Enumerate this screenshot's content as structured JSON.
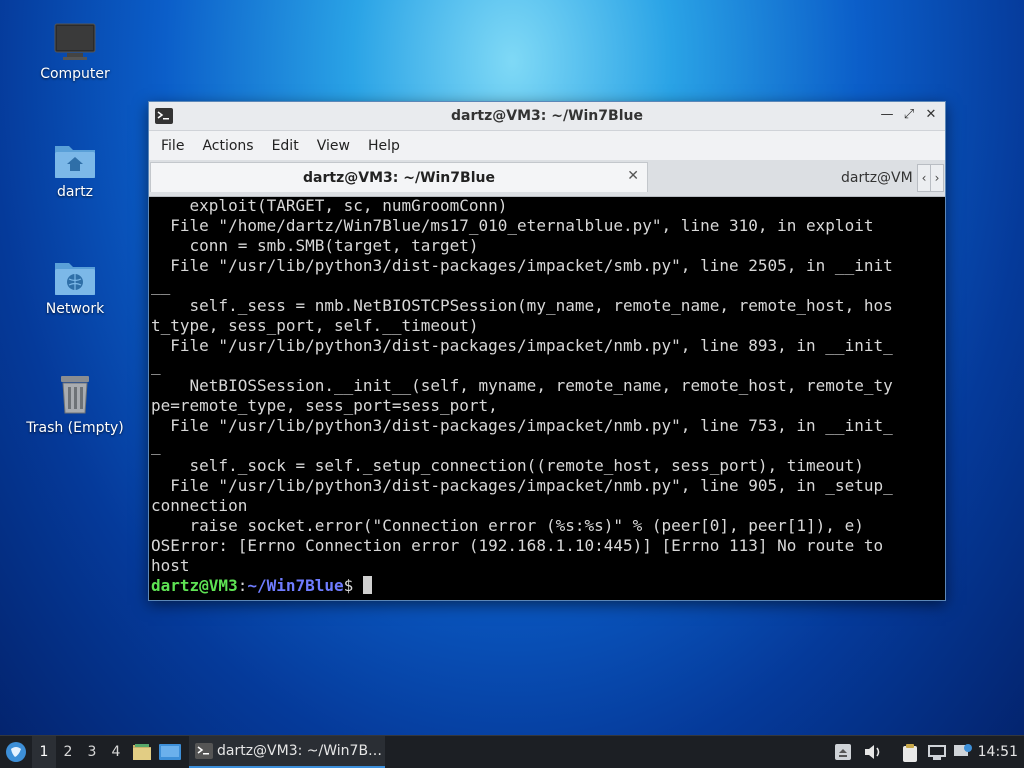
{
  "desktop": {
    "icons": [
      {
        "label": "Computer"
      },
      {
        "label": "dartz"
      },
      {
        "label": "Network"
      },
      {
        "label": "Trash (Empty)"
      }
    ]
  },
  "window": {
    "title": "dartz@VM3: ~/Win7Blue",
    "menu": [
      "File",
      "Actions",
      "Edit",
      "View",
      "Help"
    ],
    "tabs": [
      {
        "label": "dartz@VM3: ~/Win7Blue",
        "active": true
      },
      {
        "label": "dartz@VM",
        "active": false
      }
    ]
  },
  "terminal": {
    "lines": [
      "    exploit(TARGET, sc, numGroomConn)",
      "  File \"/home/dartz/Win7Blue/ms17_010_eternalblue.py\", line 310, in exploit",
      "    conn = smb.SMB(target, target)",
      "  File \"/usr/lib/python3/dist-packages/impacket/smb.py\", line 2505, in __init",
      "__",
      "    self._sess = nmb.NetBIOSTCPSession(my_name, remote_name, remote_host, hos",
      "t_type, sess_port, self.__timeout)",
      "  File \"/usr/lib/python3/dist-packages/impacket/nmb.py\", line 893, in __init_",
      "_",
      "    NetBIOSSession.__init__(self, myname, remote_name, remote_host, remote_ty",
      "pe=remote_type, sess_port=sess_port,",
      "  File \"/usr/lib/python3/dist-packages/impacket/nmb.py\", line 753, in __init_",
      "_",
      "    self._sock = self._setup_connection((remote_host, sess_port), timeout)",
      "  File \"/usr/lib/python3/dist-packages/impacket/nmb.py\", line 905, in _setup_",
      "connection",
      "    raise socket.error(\"Connection error (%s:%s)\" % (peer[0], peer[1]), e)",
      "OSError: [Errno Connection error (192.168.1.10:445)] [Errno 113] No route to",
      "host"
    ],
    "prompt": {
      "user": "dartz@VM3",
      "sep": ":",
      "path": "~/Win7Blue",
      "symbol": "$ "
    }
  },
  "taskbar": {
    "workspaces": [
      "1",
      "2",
      "3",
      "4"
    ],
    "active_task": "dartz@VM3: ~/Win7B…",
    "clock": "14:51"
  }
}
